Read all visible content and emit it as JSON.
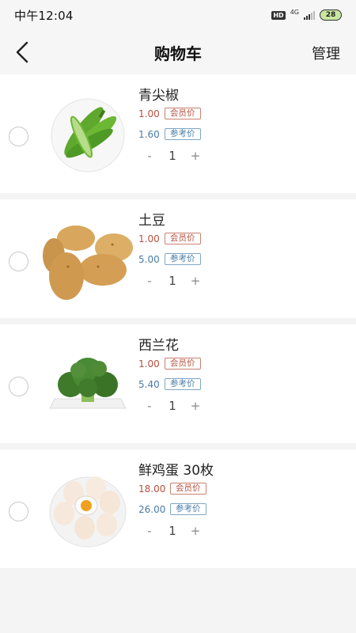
{
  "status_bar": {
    "time": "中午12:04",
    "hd_badge": "HD",
    "network": "4G",
    "battery": "28"
  },
  "header": {
    "title": "购物车",
    "manage_label": "管理",
    "back_icon": "chevron-left-icon"
  },
  "items": [
    {
      "name": "青尖椒",
      "member_price": "1.00",
      "member_tag": "会员价",
      "ref_price": "1.60",
      "ref_tag": "参考价",
      "quantity": "1",
      "minus": "-",
      "plus": "+",
      "image": "green-pepper-image"
    },
    {
      "name": "土豆",
      "member_price": "1.00",
      "member_tag": "会员价",
      "ref_price": "5.00",
      "ref_tag": "参考价",
      "quantity": "1",
      "minus": "-",
      "plus": "+",
      "image": "potato-image"
    },
    {
      "name": "西兰花",
      "member_price": "1.00",
      "member_tag": "会员价",
      "ref_price": "5.40",
      "ref_tag": "参考价",
      "quantity": "1",
      "minus": "-",
      "plus": "+",
      "image": "broccoli-image"
    },
    {
      "name": "鲜鸡蛋 30枚",
      "member_price": "18.00",
      "member_tag": "会员价",
      "ref_price": "26.00",
      "ref_tag": "参考价",
      "quantity": "1",
      "minus": "-",
      "plus": "+",
      "image": "eggs-image"
    }
  ],
  "colors": {
    "member_price": "#b5503c",
    "ref_price": "#4a7ca6",
    "background": "#f4f4f4"
  }
}
